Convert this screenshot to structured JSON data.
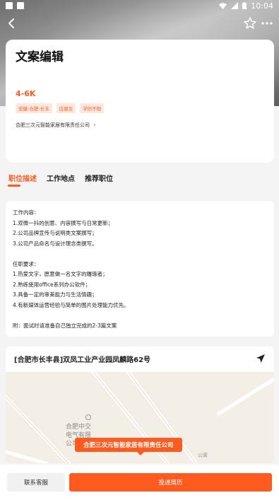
{
  "status_bar": {
    "time": "10:04"
  },
  "job": {
    "title": "文案编辑",
    "salary": "4-6K",
    "tags": [
      "安徽-合肥-长丰",
      "应届生",
      "学历不限"
    ],
    "company": "合肥三次元智能家居有限责任公司"
  },
  "tabs": [
    "职位描述",
    "工作地点",
    "推荐职位"
  ],
  "description": {
    "lines": [
      "工作内容：",
      "1.双微一抖的创意、内容撰写与日常更新；",
      "2.公司品牌宣传与说明类文案撰写；",
      "3.公司产品命名与设计理念类撰写。",
      "",
      "任职要求：",
      "1.热爱文字，愿意做一名文字的雕琢者；",
      "2.熟练使用office系列办公软件；",
      "3.具备一定的审美能力与生活情趣；",
      "4.有新媒体运营经验与简单的图片处理能力优先。",
      "",
      "附：面试时请准备自己独立完成的2-3篇文案"
    ]
  },
  "location": {
    "address": "[合肥市长丰县]双凤工业产业园凤麟路62号",
    "map_poi": "合肥中交电气有限公司",
    "map_marker": "合肥三次元智能家居有限责任公司",
    "map_small": "公寓"
  },
  "bottom": {
    "contact": "联系客服",
    "apply": "投递简历"
  },
  "colors": {
    "accent": "#ff5a1f"
  }
}
